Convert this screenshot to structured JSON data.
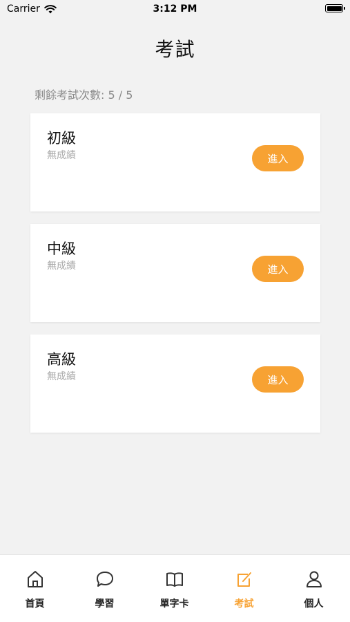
{
  "status_bar": {
    "carrier": "Carrier",
    "time": "3:12 PM"
  },
  "page": {
    "title": "考試",
    "remaining_label": "剩餘考試次數: 5 / 5"
  },
  "exams": [
    {
      "title": "初級",
      "score": "無成績",
      "button": "進入"
    },
    {
      "title": "中級",
      "score": "無成績",
      "button": "進入"
    },
    {
      "title": "高級",
      "score": "無成績",
      "button": "進入"
    }
  ],
  "tabbar": {
    "active": "考試",
    "active_color": "#f7a233",
    "items": [
      {
        "label": "首頁",
        "icon": "home-icon"
      },
      {
        "label": "學習",
        "icon": "chat-bubble-icon"
      },
      {
        "label": "單字卡",
        "icon": "book-icon"
      },
      {
        "label": "考試",
        "icon": "edit-icon"
      },
      {
        "label": "個人",
        "icon": "person-icon"
      }
    ]
  }
}
